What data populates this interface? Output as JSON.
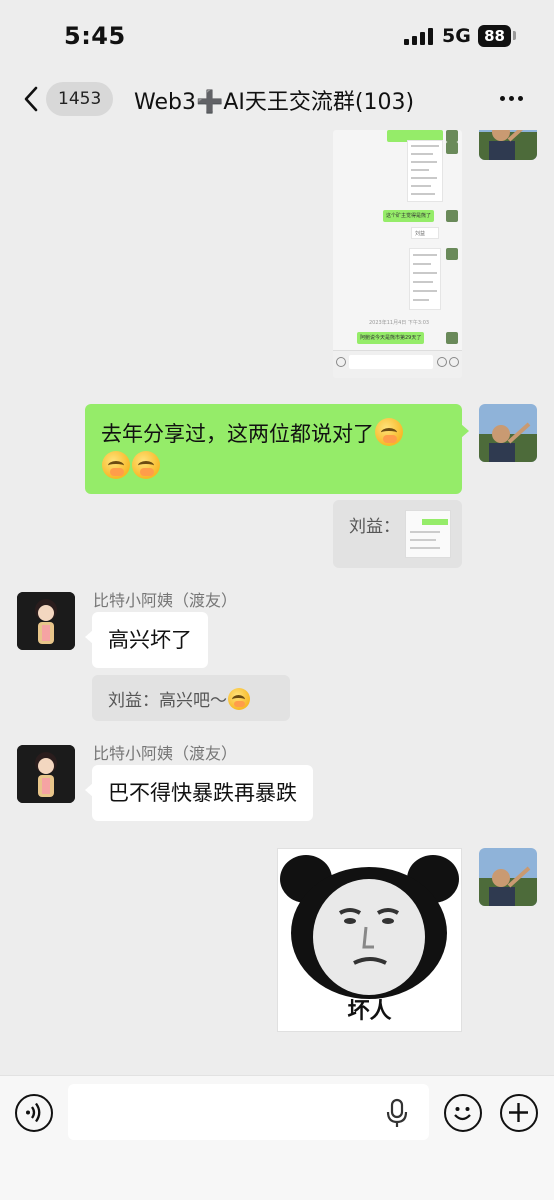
{
  "status_bar": {
    "time": "5:45",
    "network": "5G",
    "battery": "88"
  },
  "nav": {
    "unread_count": "1453",
    "title": "Web3➕AI天王交流群(103)"
  },
  "messages": {
    "screenshot_thumbnail": {
      "bubble_1": "这个矿主觉得是熊了",
      "bubble_2": "刘益",
      "date": "2023年11月4日 下午3:03",
      "bubble_3": "阿鲍说今天是熊市第29天了"
    },
    "self_text": "去年分享过，这两位都说对了",
    "quoted_image_label": "刘益：",
    "other_1": {
      "sender": "比特小阿姨（渡友）",
      "text": "高兴坏了",
      "quote": "刘益：高兴吧～"
    },
    "other_2": {
      "sender": "比特小阿姨（渡友）",
      "text": "巴不得快暴跌再暴跌"
    },
    "sticker_caption": "坏人"
  },
  "input": {
    "placeholder": ""
  },
  "colors": {
    "self_bubble": "#95ec69",
    "other_bubble": "#ffffff",
    "background": "#ededed"
  },
  "icons": [
    "back-icon",
    "more-icon",
    "voice-icon",
    "mic-icon",
    "emoji-icon",
    "plus-icon"
  ]
}
